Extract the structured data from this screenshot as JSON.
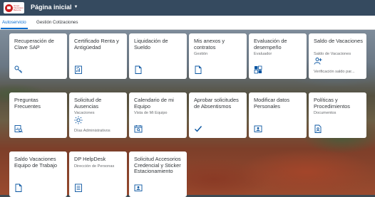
{
  "header": {
    "title": "Página inicial",
    "logo_text": "Grupo Financiero Banorte"
  },
  "tabs": [
    {
      "label": "Autoservicio",
      "active": true
    },
    {
      "label": "Gestión Cotizaciones",
      "active": false
    }
  ],
  "tiles": [
    {
      "title": "Recuperación de Clave SAP",
      "subtitle": "",
      "footer": "",
      "icon": "key-icon"
    },
    {
      "title": "Certificado Renta y Antigüedad",
      "subtitle": "",
      "footer": "",
      "icon": "document-chart-icon"
    },
    {
      "title": "Liquidación de Sueldo",
      "subtitle": "",
      "footer": "",
      "icon": "document-icon"
    },
    {
      "title": "Mis anexos y contratos",
      "subtitle": "Gestión",
      "footer": "",
      "icon": "document-icon"
    },
    {
      "title": "Evaluación de desempeño",
      "subtitle": "Evaluador",
      "footer": "",
      "icon": "checklist-icon"
    },
    {
      "title": "Saldo de Vacaciones",
      "subtitle": "Saldo de Vacaciones",
      "footer": "Verificación saldo par...",
      "icon": "add-person-icon"
    },
    {
      "title": "Preguntas Frecuentes",
      "subtitle": "",
      "footer": "",
      "icon": "report-search-icon"
    },
    {
      "title": "Solicitud de Ausencias",
      "subtitle": "Vacaciones",
      "footer": "Días Administrativos",
      "icon": "sun-icon"
    },
    {
      "title": "Calendario de mi Equipo",
      "subtitle": "Vista de Mi Equipo",
      "footer": "",
      "icon": "calendar-search-icon"
    },
    {
      "title": "Aprobar solicitudes de Absentismos",
      "subtitle": "",
      "footer": "",
      "icon": "checkmark-icon"
    },
    {
      "title": "Modificar datos Personales",
      "subtitle": "",
      "footer": "",
      "icon": "id-card-icon"
    },
    {
      "title": "Políticas y Procedimientos",
      "subtitle": "Documentos",
      "footer": "",
      "icon": "document-person-icon"
    },
    {
      "title": "Saldo Vacaciones Equipo de Trabajo",
      "subtitle": "",
      "footer": "",
      "icon": "document-icon"
    },
    {
      "title": "DP HelpDesk",
      "subtitle": "Dirección de Personas",
      "footer": "",
      "icon": "document-list-icon"
    },
    {
      "title": "Solicitud Accesorios Credencial y Sticker Estacionamiento",
      "subtitle": "",
      "footer": "",
      "icon": "id-card-icon"
    }
  ],
  "colors": {
    "shell": "#354a5f",
    "accent": "#0a6ed1",
    "icon": "#0854a0"
  }
}
